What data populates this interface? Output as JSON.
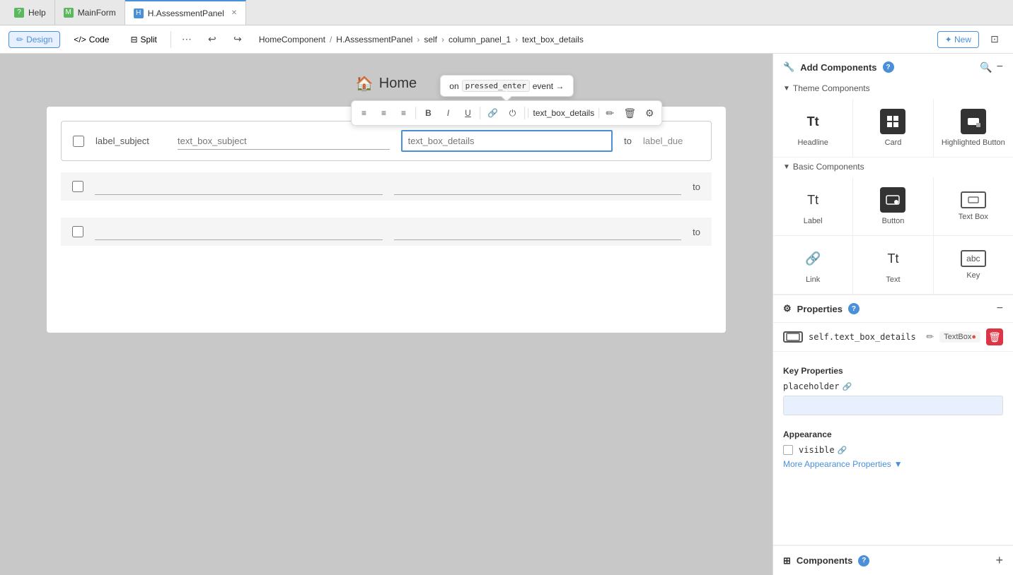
{
  "tabs": [
    {
      "id": "help",
      "label": "Help",
      "icon": "?",
      "iconBg": "green",
      "active": false,
      "closable": false
    },
    {
      "id": "mainform",
      "label": "MainForm",
      "icon": "M",
      "iconBg": "green",
      "active": false,
      "closable": false
    },
    {
      "id": "assessmentpanel",
      "label": "H.AssessmentPanel",
      "icon": "H",
      "iconBg": "blue",
      "active": true,
      "closable": true
    }
  ],
  "toolbar": {
    "design_label": "Design",
    "code_label": "Code",
    "split_label": "Split",
    "new_label": "✦ New"
  },
  "breadcrumb": {
    "parts": [
      "HomeComponent",
      "H.AssessmentPanel",
      "self",
      "column_panel_1",
      "text_box_details"
    ]
  },
  "canvas": {
    "title": "Home",
    "title_icon": "🏠"
  },
  "form": {
    "rows": [
      {
        "id": "row1",
        "has_checkbox": true,
        "label": "label_subject",
        "input1_placeholder": "text_box_subject",
        "input2_placeholder": "text_box_details",
        "input2_highlighted": true,
        "has_to": true,
        "label_due": "label_due",
        "active": true
      },
      {
        "id": "row2",
        "has_checkbox": true,
        "input1_placeholder": "",
        "input2_placeholder": "",
        "has_to": true
      },
      {
        "id": "row3",
        "has_checkbox": true,
        "input1_placeholder": "",
        "input2_placeholder": "",
        "has_to": true
      }
    ]
  },
  "floating_toolbar": {
    "align_left": "≡",
    "align_center": "≡",
    "align_right": "≡",
    "bold": "B",
    "italic": "I",
    "underline": "U",
    "link": "🔗",
    "power": "⏻",
    "component_name": "text_box_details",
    "edit": "✏",
    "delete": "🗑",
    "settings": "⚙"
  },
  "event_tooltip": {
    "prefix": "on",
    "event_key": "pressed_enter",
    "suffix": "event →"
  },
  "right_panel": {
    "add_components_title": "Add Components",
    "help_badge": "?",
    "theme_components_title": "Theme Components",
    "theme_components": [
      {
        "id": "headline",
        "label": "Headline",
        "icon": "Tt"
      },
      {
        "id": "card",
        "label": "Card",
        "icon": "⊞"
      },
      {
        "id": "highlighted_button",
        "label": "Highlighted Button",
        "icon": "HB"
      }
    ],
    "basic_components_title": "Basic Components",
    "basic_components": [
      {
        "id": "label",
        "label": "Label",
        "icon": "Tt"
      },
      {
        "id": "button",
        "label": "Button",
        "icon": "B"
      },
      {
        "id": "text_box",
        "label": "Text Box",
        "icon": "⊟"
      },
      {
        "id": "link",
        "label": "Link",
        "icon": "🔗"
      },
      {
        "id": "text",
        "label": "Text",
        "icon": "Tt"
      },
      {
        "id": "key",
        "label": "Key",
        "icon": "⌨"
      }
    ],
    "properties_title": "Properties",
    "properties_help_badge": "?",
    "component_ref": "self.text_box_details",
    "component_type": "TextBox",
    "key_properties_title": "Key Properties",
    "placeholder_key": "placeholder",
    "placeholder_value": "",
    "appearance_title": "Appearance",
    "visible_key": "visible",
    "more_appearance": "More Appearance Properties",
    "components_title": "Components",
    "components_help_badge": "?"
  }
}
